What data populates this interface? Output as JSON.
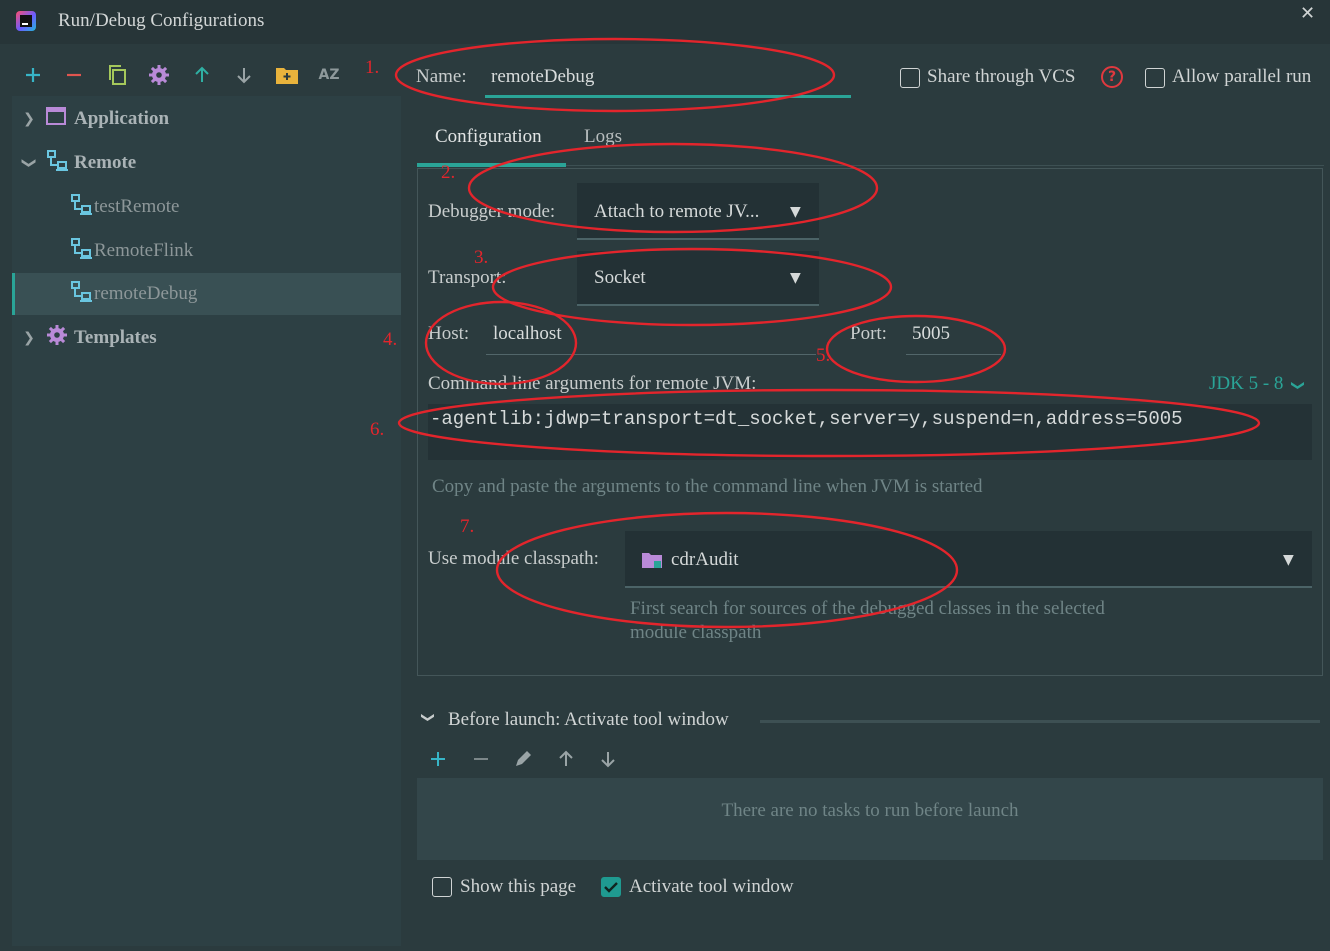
{
  "window": {
    "title": "Run/Debug Configurations"
  },
  "toolbar": {
    "icons": [
      "add-icon",
      "remove-icon",
      "copy-icon",
      "settings-icon",
      "move-up-icon",
      "move-down-icon",
      "new-folder-icon",
      "sort-az-icon"
    ],
    "sort_label": "AZ"
  },
  "tree": {
    "items": [
      {
        "label": "Application",
        "expanded": false
      },
      {
        "label": "Remote",
        "expanded": true
      },
      {
        "label": "testRemote"
      },
      {
        "label": "RemoteFlink"
      },
      {
        "label": "remoteDebug",
        "selected": true
      },
      {
        "label": "Templates",
        "expanded": false
      }
    ]
  },
  "form": {
    "name_label": "Name:",
    "name_value": "remoteDebug",
    "share_label": "Share through VCS",
    "share_checked": false,
    "help_icon": "?",
    "parallel_label": "Allow parallel run",
    "parallel_checked": false,
    "tabs": [
      "Configuration",
      "Logs"
    ],
    "active_tab": "Configuration",
    "debugger_mode_label": "Debugger mode:",
    "debugger_mode_value": "Attach to remote JV...",
    "transport_label": "Transport:",
    "transport_value": "Socket",
    "host_label": "Host:",
    "host_value": "localhost",
    "port_label": "Port:",
    "port_value": "5005",
    "cmd_label": "Command line arguments for remote JVM:",
    "jdk_label": "JDK 5 - 8",
    "cmd_value": "-agentlib:jdwp=transport=dt_socket,server=y,suspend=n,address=5005",
    "cmd_hint": "Copy and paste the arguments to the command line when JVM is started",
    "module_label": "Use module classpath:",
    "module_value": "cdrAudit",
    "module_hint_1": "First search for sources of the debugged classes in the selected",
    "module_hint_2": "module classpath"
  },
  "before_launch": {
    "title": "Before launch: Activate tool window",
    "icons": [
      "add-icon",
      "remove-icon",
      "edit-icon",
      "move-up-icon",
      "move-down-icon"
    ],
    "empty_text": "There are no tasks to run before launch",
    "show_page_label": "Show this page",
    "show_page_checked": false,
    "activate_label": "Activate tool window",
    "activate_checked": true
  },
  "annotations": [
    "1.",
    "2.",
    "3.",
    "4.",
    "5.",
    "6.",
    "7."
  ],
  "colors": {
    "accent": "#2aa497",
    "annotation": "#e3252c",
    "background": "#2b3b3e",
    "tree_bg": "#2d4044"
  }
}
